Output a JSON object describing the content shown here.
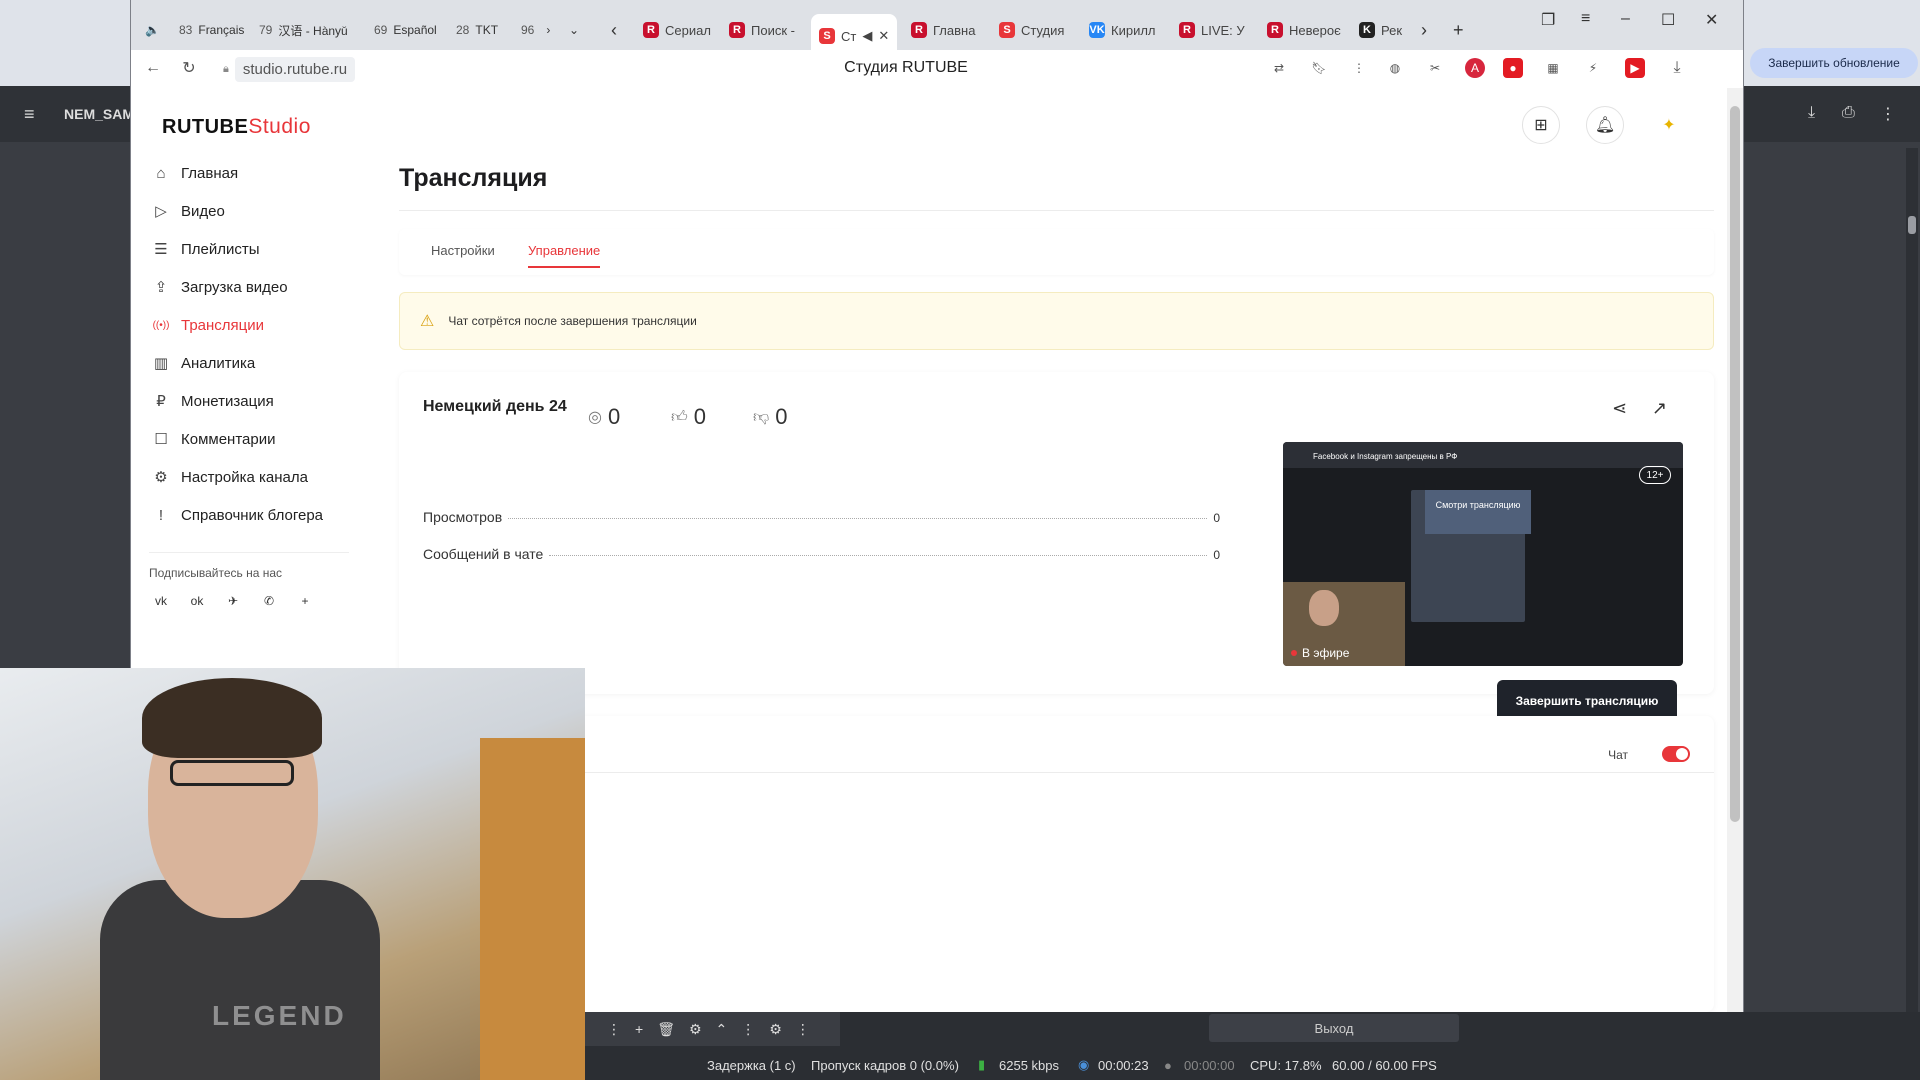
{
  "outer": {
    "profile_name": "NEM_SAM",
    "update_button": "Завершить обновление"
  },
  "lang_tabs": [
    {
      "num": "83",
      "label": "Français"
    },
    {
      "num": "79",
      "label": "汉语 - Hànyǔ"
    },
    {
      "num": "69",
      "label": "Español"
    },
    {
      "num": "28",
      "label": "TKT"
    },
    {
      "num": "96",
      "label": ""
    }
  ],
  "tabs": [
    {
      "label": "Сериал",
      "favicon": "R",
      "color": "#c8102e"
    },
    {
      "label": "Поиск -",
      "favicon": "R",
      "color": "#c8102e"
    },
    {
      "label": "Ст",
      "favicon": "S",
      "color": "#e8363a",
      "active": true
    },
    {
      "label": "Главна",
      "favicon": "R",
      "color": "#c8102e"
    },
    {
      "label": "Студия",
      "favicon": "S",
      "color": "#e8363a"
    },
    {
      "label": "Кирилл",
      "favicon": "VK",
      "color": "#2787f5"
    },
    {
      "label": "LIVE: У",
      "favicon": "R",
      "color": "#c8102e"
    },
    {
      "label": "Невероє",
      "favicon": "R",
      "color": "#c8102e"
    },
    {
      "label": "Рек",
      "favicon": "K",
      "color": "#222222"
    }
  ],
  "address": {
    "url": "studio.rutube.ru",
    "page_title": "Студия RUTUBE"
  },
  "logo": {
    "rutube": "RUTUBE",
    "studio": "Studio"
  },
  "sidebar": {
    "items": [
      {
        "label": "Главная",
        "icon": "home-icon",
        "glyph": "⌂"
      },
      {
        "label": "Видео",
        "icon": "video-icon",
        "glyph": "▷"
      },
      {
        "label": "Плейлисты",
        "icon": "playlist-icon",
        "glyph": "☰"
      },
      {
        "label": "Загрузка видео",
        "icon": "upload-icon",
        "glyph": "⇪"
      },
      {
        "label": "Трансляции",
        "icon": "broadcast-icon",
        "glyph": "((•))",
        "active": true
      },
      {
        "label": "Аналитика",
        "icon": "analytics-icon",
        "glyph": "▥"
      },
      {
        "label": "Монетизация",
        "icon": "monetization-icon",
        "glyph": "₽"
      },
      {
        "label": "Комментарии",
        "icon": "comments-icon",
        "glyph": "☐"
      },
      {
        "label": "Настройка канала",
        "icon": "settings-icon",
        "glyph": "⚙"
      },
      {
        "label": "Справочник блогера",
        "icon": "help-icon",
        "glyph": "!"
      }
    ],
    "follow_label": "Подписывайтесь на нас",
    "socials": [
      {
        "icon": "vk-icon",
        "glyph": "vk"
      },
      {
        "icon": "ok-icon",
        "glyph": "ok"
      },
      {
        "icon": "telegram-icon",
        "glyph": "✈"
      },
      {
        "icon": "viber-icon",
        "glyph": "✆"
      },
      {
        "icon": "more-icon",
        "glyph": "+"
      }
    ]
  },
  "main": {
    "title": "Трансляция",
    "tabs": [
      "Настройки",
      "Управление"
    ],
    "active_tab": "Управление",
    "notice": "Чат сотрётся после завершения трансляции"
  },
  "stream": {
    "name": "Немецкий день 24",
    "stats": [
      {
        "label": "Просмотров",
        "value": "0"
      },
      {
        "label": "Сообщений в чате",
        "value": "0"
      }
    ],
    "preview": {
      "title": "Facebook и Instagram запрещены в РФ",
      "inner_text": "Смотри трансляцию",
      "age": "12+",
      "live": "В эфире"
    },
    "counters": {
      "viewers": "0",
      "likes": "0",
      "dislikes": "0"
    },
    "end_button": "Завершить трансляцию"
  },
  "chat": {
    "label": "Чат",
    "enabled": true
  },
  "obs": {
    "exit": "Выход",
    "delay": "Задержка (1 с)",
    "dropped": "Пропуск кадров 0 (0.0%)",
    "bitrate": "6255 kbps",
    "stream_time": "00:00:23",
    "rec_time": "00:00:00",
    "cpu": "CPU: 17.8%",
    "fps": "60.00 / 60.00 FPS"
  },
  "webcam": {
    "shirt_text": "LEGEND"
  },
  "colors": {
    "accent": "#e8363a",
    "dark_button": "#1f232b",
    "help": "#19a091"
  }
}
